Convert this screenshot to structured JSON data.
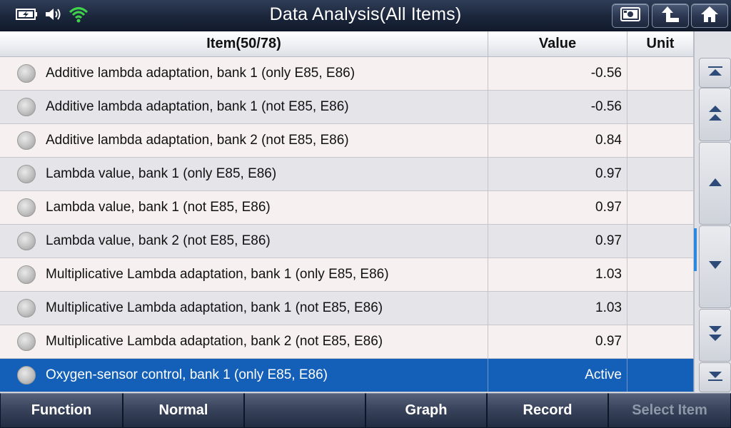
{
  "title": "Data Analysis(All Items)",
  "status_icons": [
    "battery-charging-icon",
    "speaker-icon",
    "wifi-icon"
  ],
  "title_buttons": [
    "screenshot-icon",
    "back-up-icon",
    "home-icon"
  ],
  "table": {
    "headers": {
      "item": "Item(50/78)",
      "value": "Value",
      "unit": "Unit"
    },
    "rows": [
      {
        "label": "Additive lambda adaptation, bank 1 (only E85, E86)",
        "value": "-0.56",
        "unit": ""
      },
      {
        "label": "Additive lambda adaptation, bank 1 (not E85, E86)",
        "value": "-0.56",
        "unit": ""
      },
      {
        "label": "Additive lambda adaptation, bank 2 (not E85, E86)",
        "value": "0.84",
        "unit": ""
      },
      {
        "label": "Lambda value, bank 1 (only E85, E86)",
        "value": "0.97",
        "unit": ""
      },
      {
        "label": "Lambda value, bank 1 (not E85, E86)",
        "value": "0.97",
        "unit": ""
      },
      {
        "label": "Lambda value, bank 2 (not E85, E86)",
        "value": "0.97",
        "unit": ""
      },
      {
        "label": "Multiplicative Lambda adaptation, bank 1 (only E85, E86)",
        "value": "1.03",
        "unit": ""
      },
      {
        "label": "Multiplicative Lambda adaptation, bank 1 (not E85, E86)",
        "value": "1.03",
        "unit": ""
      },
      {
        "label": "Multiplicative Lambda adaptation, bank 2 (not E85, E86)",
        "value": "0.97",
        "unit": ""
      },
      {
        "label": "Oxygen-sensor control, bank 1 (only E85, E86)",
        "value": "Active",
        "unit": ""
      }
    ],
    "selected_row_index": 9
  },
  "scroll_buttons": [
    "scroll-top-icon",
    "page-up-icon",
    "line-up-icon",
    "line-down-icon",
    "page-down-icon",
    "scroll-bottom-icon"
  ],
  "bottom_toolbar": {
    "function": "Function",
    "normal": "Normal",
    "blank": "",
    "graph": "Graph",
    "record": "Record",
    "select_item": "Select Item"
  },
  "colors": {
    "title_bar": "#1b263b",
    "selected_row": "#1460b8",
    "scroll_indicator": "#2b88e0",
    "wifi": "#3fd24a"
  }
}
